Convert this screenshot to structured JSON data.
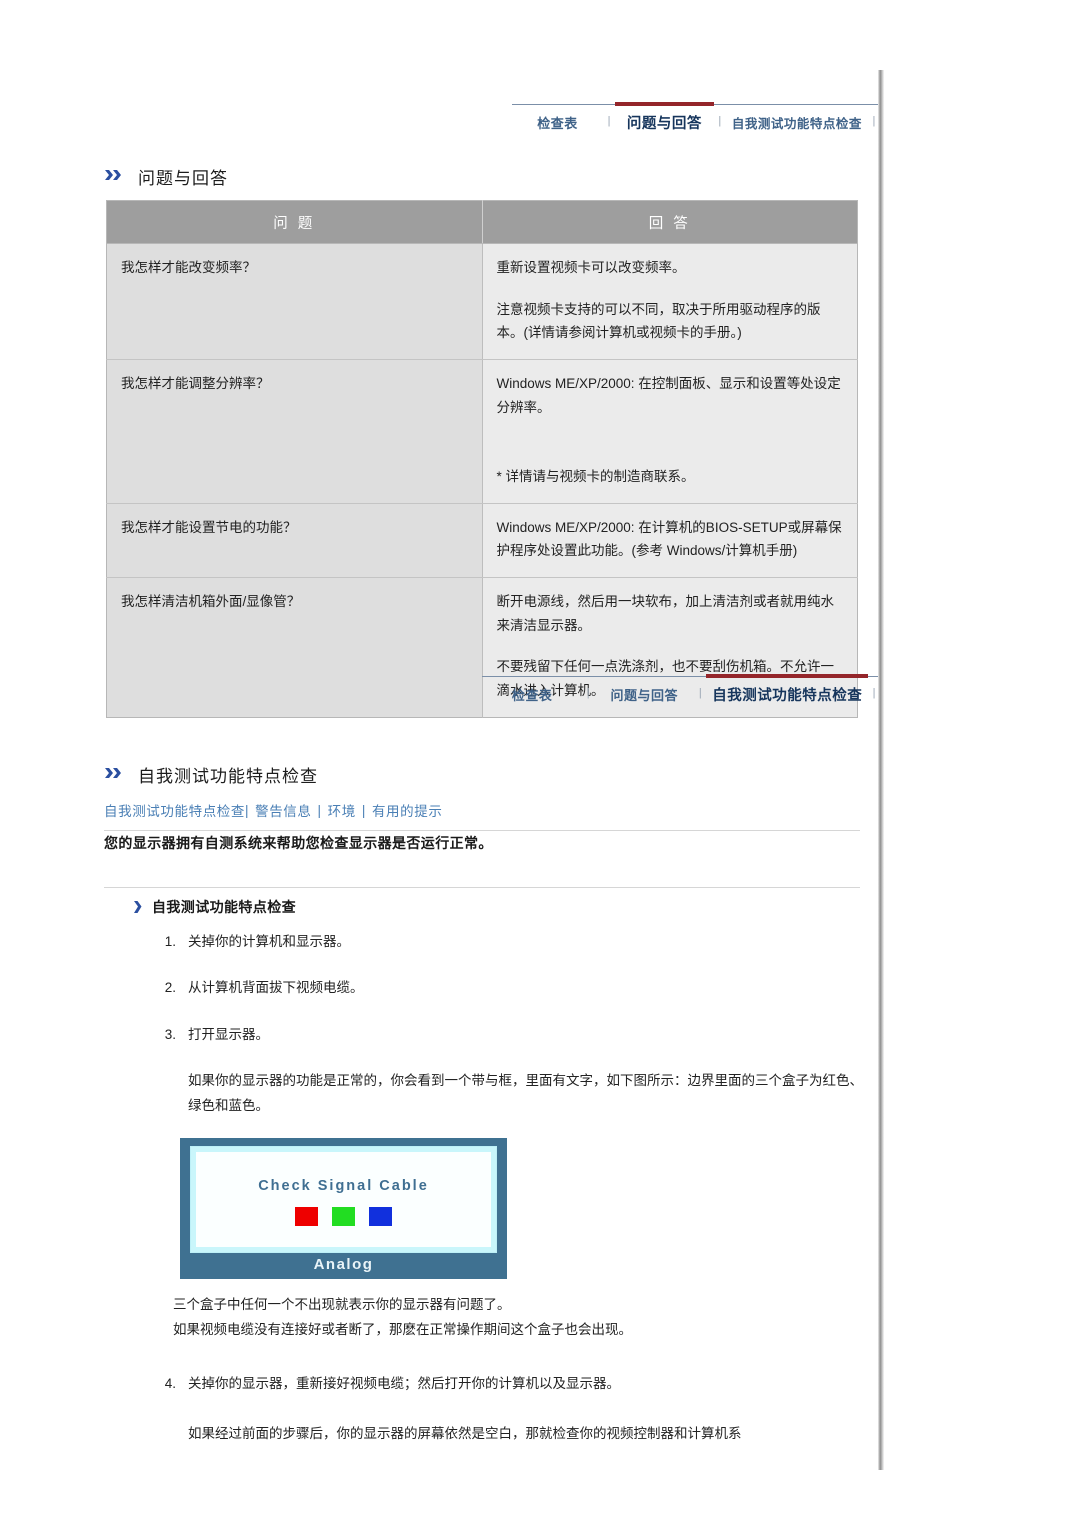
{
  "navbars": {
    "faq": {
      "tabs": [
        {
          "label": "检查表",
          "active": false
        },
        {
          "label": "问题与回答",
          "active": true
        },
        {
          "label": "自我测试功能特点检查",
          "active": false
        }
      ],
      "separator": "|"
    },
    "selftest": {
      "tabs": [
        {
          "label": "检查表",
          "active": false
        },
        {
          "label": "问题与回答",
          "active": false
        },
        {
          "label": "自我测试功能特点检查",
          "active": true
        }
      ],
      "separator": "|"
    }
  },
  "faq_section": {
    "heading": "问题与回答",
    "table": {
      "headers": [
        "问 题",
        "回 答"
      ],
      "rows": [
        {
          "question": "我怎样才能改变频率？",
          "answer": [
            "重新设置视频卡可以改变频率。",
            "注意视频卡支持的可以不同，取决于所用驱动程序的版本。(详情请参阅计算机或视频卡的手册。)"
          ]
        },
        {
          "question": "我怎样才能调整分辨率？",
          "answer": [
            "Windows ME/XP/2000: 在控制面板、显示和设置等处设定分辨率。",
            "* 详情请与视频卡的制造商联系。"
          ]
        },
        {
          "question": "我怎样才能设置节电的功能？",
          "answer": [
            "Windows ME/XP/2000: 在计算机的BIOS-SETUP或屏幕保护程序处设置此功能。(参考 Windows/计算机手册)"
          ]
        },
        {
          "question": "我怎样清洁机箱外面/显像管？",
          "answer": [
            "断开电源线，然后用一块软布，加上清洁剂或者就用纯水来清洁显示器。",
            "不要残留下任何一点洗涤剂，也不要刮伤机箱。不允许一滴水进入计算机。"
          ]
        }
      ]
    }
  },
  "selftest_section": {
    "heading": "自我测试功能特点检查",
    "subnav": [
      {
        "label": "自我测试功能特点检查"
      },
      {
        "label": "警告信息"
      },
      {
        "label": "环境"
      },
      {
        "label": "有用的提示"
      }
    ],
    "subnav_separator": "|",
    "lead": "您的显示器拥有自测系统来帮助您检查显示器是否运行正常。",
    "sub_heading": "自我测试功能特点检查",
    "steps": [
      {
        "num": "1.",
        "text": "关掉你的计算机和显示器。"
      },
      {
        "num": "2.",
        "text": "从计算机背面拔下视频电缆。"
      },
      {
        "num": "3.",
        "text": "打开显示器。"
      }
    ],
    "step3_note": "如果你的显示器的功能是正常的，你会看到一个带与框，里面有文字，如下图所示：边界里面的三个盒子为红色、绿色和蓝色。",
    "monitor_graphic": {
      "title": "Check Signal Cable",
      "footer": "Analog",
      "swatch_colors": [
        "#ee0000",
        "#22dd22",
        "#1130dd"
      ],
      "frame_color": "#3f7191",
      "screen_glow": "#c9f6fb"
    },
    "after_monitor": [
      "三个盒子中任何一个不出现就表示你的显示器有问题了。",
      "如果视频电缆没有连接好或者断了，那麽在正常操作期间这个盒子也会出现。"
    ],
    "step4": {
      "num": "4.",
      "text": "关掉你的显示器，重新接好视频电缆；然后打开你的计算机以及显示器。"
    },
    "step4_note": "如果经过前面的步骤后，你的显示器的屏幕依然是空白，那就检查你的视频控制器和计算机系"
  },
  "colors": {
    "active_tab_underline": "#94252a",
    "tab_link": "#3f6288",
    "table_header_bg": "#9e9e9e",
    "question_cell_bg": "#dedede",
    "answer_cell_bg": "#ebebeb",
    "link_blue": "#4a7fb5",
    "chevron_blue": "#2b4fa0"
  }
}
